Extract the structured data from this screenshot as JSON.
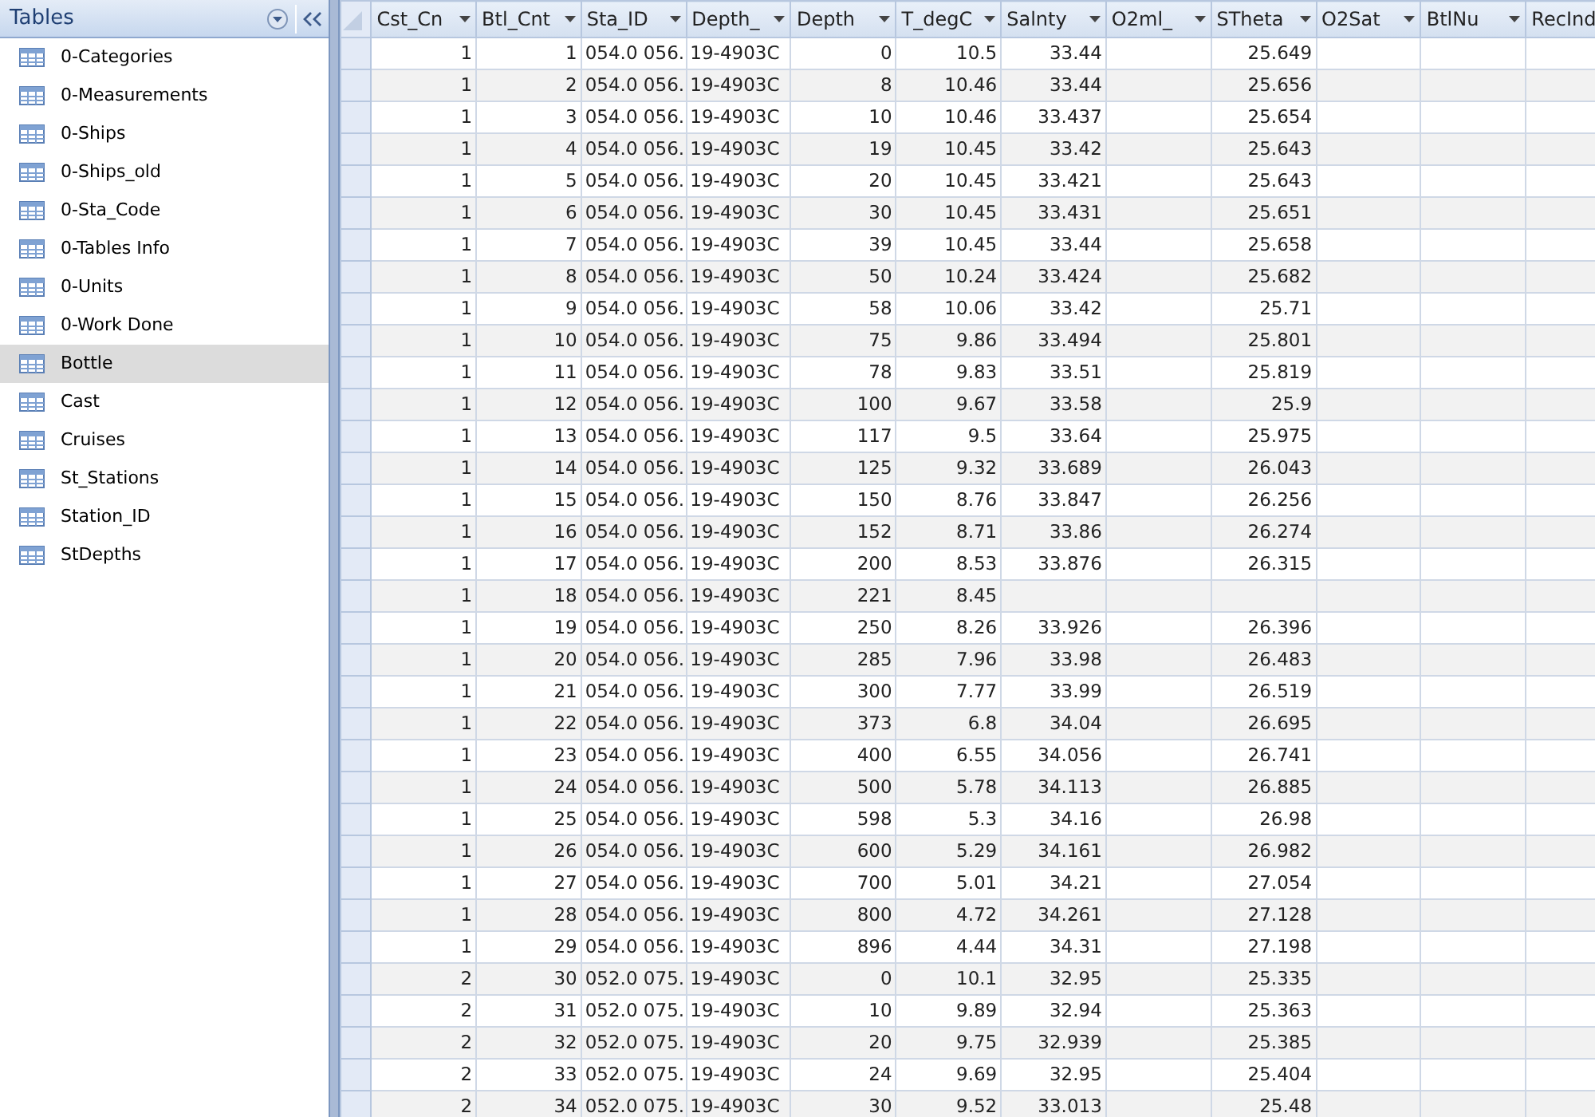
{
  "navigation_pane": {
    "title": "Tables",
    "items": [
      {
        "label": "0-Categories",
        "selected": false
      },
      {
        "label": "0-Measurements",
        "selected": false
      },
      {
        "label": "0-Ships",
        "selected": false
      },
      {
        "label": "0-Ships_old",
        "selected": false
      },
      {
        "label": "0-Sta_Code",
        "selected": false
      },
      {
        "label": "0-Tables Info",
        "selected": false
      },
      {
        "label": "0-Units",
        "selected": false
      },
      {
        "label": "0-Work Done",
        "selected": false
      },
      {
        "label": "Bottle",
        "selected": true
      },
      {
        "label": "Cast",
        "selected": false
      },
      {
        "label": "Cruises",
        "selected": false
      },
      {
        "label": "St_Stations",
        "selected": false
      },
      {
        "label": "Station_ID",
        "selected": false
      },
      {
        "label": "StDepths",
        "selected": false
      }
    ]
  },
  "table": {
    "columns": [
      {
        "label": "Cst_Cn",
        "kind": "number"
      },
      {
        "label": "Btl_Cnt",
        "kind": "number"
      },
      {
        "label": "Sta_ID",
        "kind": "text"
      },
      {
        "label": "Depth_",
        "kind": "text"
      },
      {
        "label": "Depth",
        "kind": "number"
      },
      {
        "label": "T_degC",
        "kind": "number"
      },
      {
        "label": "Salnty",
        "kind": "number"
      },
      {
        "label": "O2ml_",
        "kind": "number"
      },
      {
        "label": "STheta",
        "kind": "number"
      },
      {
        "label": "O2Sat",
        "kind": "number"
      },
      {
        "label": "BtlNu",
        "kind": "number"
      },
      {
        "label": "RecInd",
        "kind": "number"
      }
    ],
    "rows": [
      [
        "1",
        "1",
        "054.0 056.",
        "19-4903C",
        "0",
        "10.5",
        "33.44",
        null,
        "25.649"
      ],
      [
        "1",
        "2",
        "054.0 056.",
        "19-4903C",
        "8",
        "10.46",
        "33.44",
        null,
        "25.656"
      ],
      [
        "1",
        "3",
        "054.0 056.",
        "19-4903C",
        "10",
        "10.46",
        "33.437",
        null,
        "25.654"
      ],
      [
        "1",
        "4",
        "054.0 056.",
        "19-4903C",
        "19",
        "10.45",
        "33.42",
        null,
        "25.643"
      ],
      [
        "1",
        "5",
        "054.0 056.",
        "19-4903C",
        "20",
        "10.45",
        "33.421",
        null,
        "25.643"
      ],
      [
        "1",
        "6",
        "054.0 056.",
        "19-4903C",
        "30",
        "10.45",
        "33.431",
        null,
        "25.651"
      ],
      [
        "1",
        "7",
        "054.0 056.",
        "19-4903C",
        "39",
        "10.45",
        "33.44",
        null,
        "25.658"
      ],
      [
        "1",
        "8",
        "054.0 056.",
        "19-4903C",
        "50",
        "10.24",
        "33.424",
        null,
        "25.682"
      ],
      [
        "1",
        "9",
        "054.0 056.",
        "19-4903C",
        "58",
        "10.06",
        "33.42",
        null,
        "25.71"
      ],
      [
        "1",
        "10",
        "054.0 056.",
        "19-4903C",
        "75",
        "9.86",
        "33.494",
        null,
        "25.801"
      ],
      [
        "1",
        "11",
        "054.0 056.",
        "19-4903C",
        "78",
        "9.83",
        "33.51",
        null,
        "25.819"
      ],
      [
        "1",
        "12",
        "054.0 056.",
        "19-4903C",
        "100",
        "9.67",
        "33.58",
        null,
        "25.9"
      ],
      [
        "1",
        "13",
        "054.0 056.",
        "19-4903C",
        "117",
        "9.5",
        "33.64",
        null,
        "25.975"
      ],
      [
        "1",
        "14",
        "054.0 056.",
        "19-4903C",
        "125",
        "9.32",
        "33.689",
        null,
        "26.043"
      ],
      [
        "1",
        "15",
        "054.0 056.",
        "19-4903C",
        "150",
        "8.76",
        "33.847",
        null,
        "26.256"
      ],
      [
        "1",
        "16",
        "054.0 056.",
        "19-4903C",
        "152",
        "8.71",
        "33.86",
        null,
        "26.274"
      ],
      [
        "1",
        "17",
        "054.0 056.",
        "19-4903C",
        "200",
        "8.53",
        "33.876",
        null,
        "26.315"
      ],
      [
        "1",
        "18",
        "054.0 056.",
        "19-4903C",
        "221",
        "8.45",
        null,
        null,
        null
      ],
      [
        "1",
        "19",
        "054.0 056.",
        "19-4903C",
        "250",
        "8.26",
        "33.926",
        null,
        "26.396"
      ],
      [
        "1",
        "20",
        "054.0 056.",
        "19-4903C",
        "285",
        "7.96",
        "33.98",
        null,
        "26.483"
      ],
      [
        "1",
        "21",
        "054.0 056.",
        "19-4903C",
        "300",
        "7.77",
        "33.99",
        null,
        "26.519"
      ],
      [
        "1",
        "22",
        "054.0 056.",
        "19-4903C",
        "373",
        "6.8",
        "34.04",
        null,
        "26.695"
      ],
      [
        "1",
        "23",
        "054.0 056.",
        "19-4903C",
        "400",
        "6.55",
        "34.056",
        null,
        "26.741"
      ],
      [
        "1",
        "24",
        "054.0 056.",
        "19-4903C",
        "500",
        "5.78",
        "34.113",
        null,
        "26.885"
      ],
      [
        "1",
        "25",
        "054.0 056.",
        "19-4903C",
        "598",
        "5.3",
        "34.16",
        null,
        "26.98"
      ],
      [
        "1",
        "26",
        "054.0 056.",
        "19-4903C",
        "600",
        "5.29",
        "34.161",
        null,
        "26.982"
      ],
      [
        "1",
        "27",
        "054.0 056.",
        "19-4903C",
        "700",
        "5.01",
        "34.21",
        null,
        "27.054"
      ],
      [
        "1",
        "28",
        "054.0 056.",
        "19-4903C",
        "800",
        "4.72",
        "34.261",
        null,
        "27.128"
      ],
      [
        "1",
        "29",
        "054.0 056.",
        "19-4903C",
        "896",
        "4.44",
        "34.31",
        null,
        "27.198"
      ],
      [
        "2",
        "30",
        "052.0 075.",
        "19-4903C",
        "0",
        "10.1",
        "32.95",
        null,
        "25.335"
      ],
      [
        "2",
        "31",
        "052.0 075.",
        "19-4903C",
        "10",
        "9.89",
        "32.94",
        null,
        "25.363"
      ],
      [
        "2",
        "32",
        "052.0 075.",
        "19-4903C",
        "20",
        "9.75",
        "32.939",
        null,
        "25.385"
      ],
      [
        "2",
        "33",
        "052.0 075.",
        "19-4903C",
        "24",
        "9.69",
        "32.95",
        null,
        "25.404"
      ],
      [
        "2",
        "34",
        "052.0 075.",
        "19-4903C",
        "30",
        "9.52",
        "33.013",
        null,
        "25.48"
      ]
    ]
  }
}
